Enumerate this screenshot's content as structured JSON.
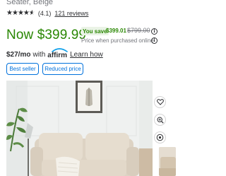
{
  "product": {
    "subtitle": "Seater, Beige",
    "rating": {
      "stars": 4.5,
      "value_text": "(4.1)",
      "reviews_text": "121 reviews"
    },
    "price": {
      "now": "Now $399.99",
      "save_label": "You save",
      "save_amount": "$399.01",
      "was": "$799.00",
      "note": "Price when purchased online"
    },
    "financing": {
      "monthly": "$27/mo",
      "with": "with",
      "brand": "affirm",
      "learn_how": "Learn how"
    },
    "badges": [
      "Best seller",
      "Reduced price"
    ]
  },
  "colors": {
    "price_green": "#2a8703",
    "accent_blue": "#0071dc",
    "save_bg": "#eaf3e6"
  },
  "icons": {
    "favorite": "heart-icon",
    "zoom": "zoom-in-icon",
    "view": "view-in-room-icon",
    "info": "info-icon"
  }
}
